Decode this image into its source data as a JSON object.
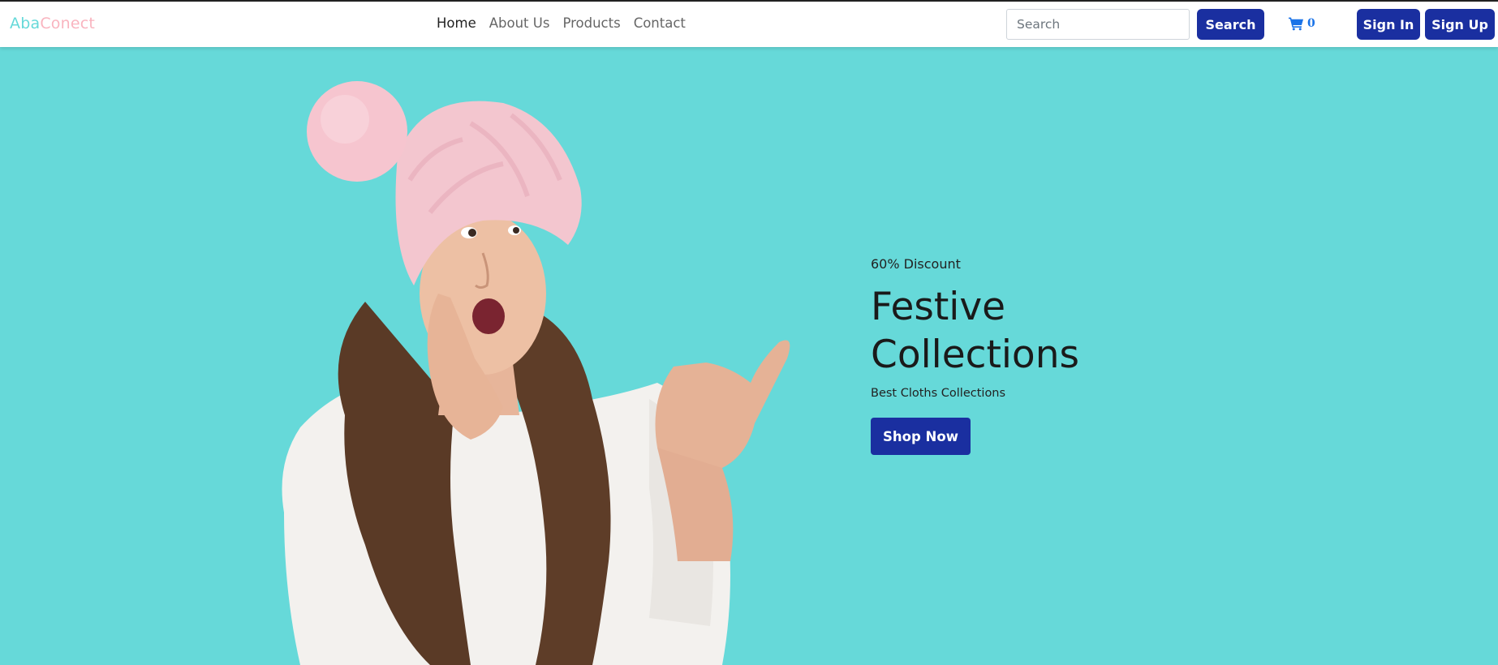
{
  "brand": {
    "part1": "Aba",
    "part2": "Conect",
    "color1": "#66d9d9",
    "color2": "#f9b4bf"
  },
  "nav": {
    "items": [
      {
        "label": "Home",
        "active": true
      },
      {
        "label": "About Us",
        "active": false
      },
      {
        "label": "Products",
        "active": false
      },
      {
        "label": "Contact",
        "active": false
      }
    ]
  },
  "search": {
    "placeholder": "Search",
    "value": "",
    "button_label": "Search"
  },
  "cart": {
    "icon": "shopping-cart-icon",
    "count": "0"
  },
  "auth": {
    "signin_label": "Sign In",
    "signup_label": "Sign Up"
  },
  "hero": {
    "discount": "60% Discount",
    "title": "Festive Collections",
    "subtitle": "Best Cloths Collections",
    "cta_label": "Shop Now",
    "image": "girl-in-pink-beanie-photo"
  },
  "colors": {
    "accent": "#1a2fa0",
    "background": "#66d9d9",
    "cart": "#1a73e8"
  }
}
